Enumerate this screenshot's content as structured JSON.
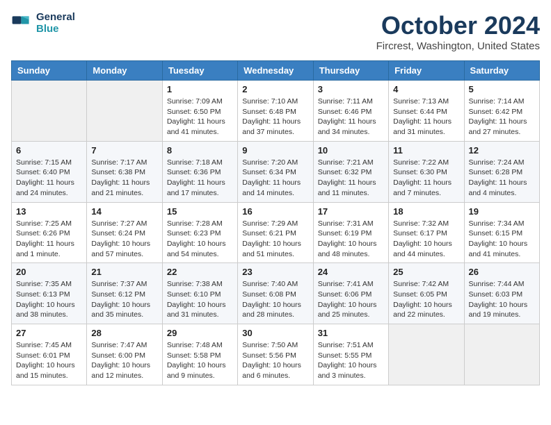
{
  "header": {
    "logo_line1": "General",
    "logo_line2": "Blue",
    "month_title": "October 2024",
    "location": "Fircrest, Washington, United States"
  },
  "weekdays": [
    "Sunday",
    "Monday",
    "Tuesday",
    "Wednesday",
    "Thursday",
    "Friday",
    "Saturday"
  ],
  "weeks": [
    [
      {
        "day": "",
        "info": ""
      },
      {
        "day": "",
        "info": ""
      },
      {
        "day": "1",
        "info": "Sunrise: 7:09 AM\nSunset: 6:50 PM\nDaylight: 11 hours and 41 minutes."
      },
      {
        "day": "2",
        "info": "Sunrise: 7:10 AM\nSunset: 6:48 PM\nDaylight: 11 hours and 37 minutes."
      },
      {
        "day": "3",
        "info": "Sunrise: 7:11 AM\nSunset: 6:46 PM\nDaylight: 11 hours and 34 minutes."
      },
      {
        "day": "4",
        "info": "Sunrise: 7:13 AM\nSunset: 6:44 PM\nDaylight: 11 hours and 31 minutes."
      },
      {
        "day": "5",
        "info": "Sunrise: 7:14 AM\nSunset: 6:42 PM\nDaylight: 11 hours and 27 minutes."
      }
    ],
    [
      {
        "day": "6",
        "info": "Sunrise: 7:15 AM\nSunset: 6:40 PM\nDaylight: 11 hours and 24 minutes."
      },
      {
        "day": "7",
        "info": "Sunrise: 7:17 AM\nSunset: 6:38 PM\nDaylight: 11 hours and 21 minutes."
      },
      {
        "day": "8",
        "info": "Sunrise: 7:18 AM\nSunset: 6:36 PM\nDaylight: 11 hours and 17 minutes."
      },
      {
        "day": "9",
        "info": "Sunrise: 7:20 AM\nSunset: 6:34 PM\nDaylight: 11 hours and 14 minutes."
      },
      {
        "day": "10",
        "info": "Sunrise: 7:21 AM\nSunset: 6:32 PM\nDaylight: 11 hours and 11 minutes."
      },
      {
        "day": "11",
        "info": "Sunrise: 7:22 AM\nSunset: 6:30 PM\nDaylight: 11 hours and 7 minutes."
      },
      {
        "day": "12",
        "info": "Sunrise: 7:24 AM\nSunset: 6:28 PM\nDaylight: 11 hours and 4 minutes."
      }
    ],
    [
      {
        "day": "13",
        "info": "Sunrise: 7:25 AM\nSunset: 6:26 PM\nDaylight: 11 hours and 1 minute."
      },
      {
        "day": "14",
        "info": "Sunrise: 7:27 AM\nSunset: 6:24 PM\nDaylight: 10 hours and 57 minutes."
      },
      {
        "day": "15",
        "info": "Sunrise: 7:28 AM\nSunset: 6:23 PM\nDaylight: 10 hours and 54 minutes."
      },
      {
        "day": "16",
        "info": "Sunrise: 7:29 AM\nSunset: 6:21 PM\nDaylight: 10 hours and 51 minutes."
      },
      {
        "day": "17",
        "info": "Sunrise: 7:31 AM\nSunset: 6:19 PM\nDaylight: 10 hours and 48 minutes."
      },
      {
        "day": "18",
        "info": "Sunrise: 7:32 AM\nSunset: 6:17 PM\nDaylight: 10 hours and 44 minutes."
      },
      {
        "day": "19",
        "info": "Sunrise: 7:34 AM\nSunset: 6:15 PM\nDaylight: 10 hours and 41 minutes."
      }
    ],
    [
      {
        "day": "20",
        "info": "Sunrise: 7:35 AM\nSunset: 6:13 PM\nDaylight: 10 hours and 38 minutes."
      },
      {
        "day": "21",
        "info": "Sunrise: 7:37 AM\nSunset: 6:12 PM\nDaylight: 10 hours and 35 minutes."
      },
      {
        "day": "22",
        "info": "Sunrise: 7:38 AM\nSunset: 6:10 PM\nDaylight: 10 hours and 31 minutes."
      },
      {
        "day": "23",
        "info": "Sunrise: 7:40 AM\nSunset: 6:08 PM\nDaylight: 10 hours and 28 minutes."
      },
      {
        "day": "24",
        "info": "Sunrise: 7:41 AM\nSunset: 6:06 PM\nDaylight: 10 hours and 25 minutes."
      },
      {
        "day": "25",
        "info": "Sunrise: 7:42 AM\nSunset: 6:05 PM\nDaylight: 10 hours and 22 minutes."
      },
      {
        "day": "26",
        "info": "Sunrise: 7:44 AM\nSunset: 6:03 PM\nDaylight: 10 hours and 19 minutes."
      }
    ],
    [
      {
        "day": "27",
        "info": "Sunrise: 7:45 AM\nSunset: 6:01 PM\nDaylight: 10 hours and 15 minutes."
      },
      {
        "day": "28",
        "info": "Sunrise: 7:47 AM\nSunset: 6:00 PM\nDaylight: 10 hours and 12 minutes."
      },
      {
        "day": "29",
        "info": "Sunrise: 7:48 AM\nSunset: 5:58 PM\nDaylight: 10 hours and 9 minutes."
      },
      {
        "day": "30",
        "info": "Sunrise: 7:50 AM\nSunset: 5:56 PM\nDaylight: 10 hours and 6 minutes."
      },
      {
        "day": "31",
        "info": "Sunrise: 7:51 AM\nSunset: 5:55 PM\nDaylight: 10 hours and 3 minutes."
      },
      {
        "day": "",
        "info": ""
      },
      {
        "day": "",
        "info": ""
      }
    ]
  ]
}
